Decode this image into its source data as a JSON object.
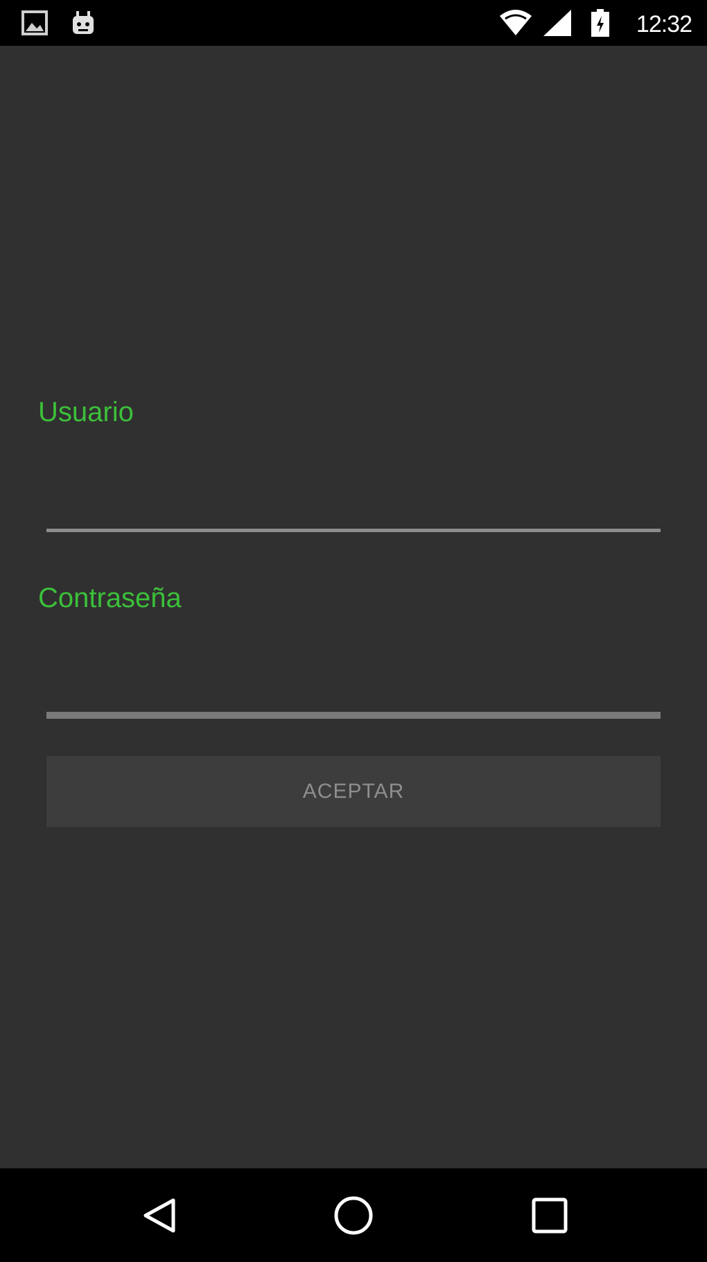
{
  "status_bar": {
    "time": "12:32",
    "icons": [
      "image-notification-icon",
      "android-notification-icon",
      "wifi-icon",
      "cell-signal-icon",
      "battery-icon"
    ]
  },
  "form": {
    "username_label": "Usuario",
    "username_value": "",
    "password_label": "Contraseña",
    "password_value": "",
    "accept_label": "ACEPTAR"
  },
  "nav_bar": {
    "icons": [
      "back-icon",
      "home-icon",
      "recents-icon"
    ]
  },
  "colors": {
    "background": "#303030",
    "label_accent": "#3cc03a",
    "button_bg": "#3d3d3d",
    "button_text": "#8e8e8e",
    "bars": "#000000"
  }
}
